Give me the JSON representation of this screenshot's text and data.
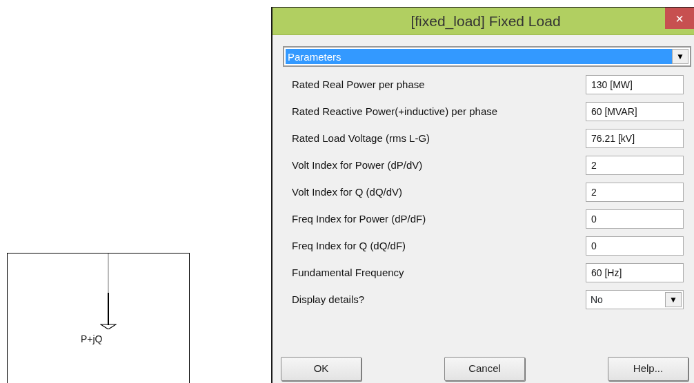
{
  "component": {
    "label": "P+jQ"
  },
  "window": {
    "title": "[fixed_load] Fixed Load",
    "close": "×"
  },
  "section_select": {
    "value": "Parameters",
    "arrow": "▼"
  },
  "parameters": [
    {
      "label": "Rated Real Power per phase",
      "kind": "text",
      "value": "130 [MW]"
    },
    {
      "label": "Rated Reactive Power(+inductive) per phase",
      "kind": "text",
      "value": "60 [MVAR]"
    },
    {
      "label": "Rated Load Voltage (rms L-G)",
      "kind": "text",
      "value": "76.21 [kV]"
    },
    {
      "label": "Volt Index for Power (dP/dV)",
      "kind": "text",
      "value": "2"
    },
    {
      "label": "Volt Index for Q (dQ/dV)",
      "kind": "text",
      "value": "2"
    },
    {
      "label": "Freq Index for Power (dP/dF)",
      "kind": "text",
      "value": "0"
    },
    {
      "label": "Freq Index for Q (dQ/dF)",
      "kind": "text",
      "value": "0"
    },
    {
      "label": "Fundamental Frequency",
      "kind": "text",
      "value": "60 [Hz]"
    },
    {
      "label": "Display details?",
      "kind": "select",
      "value": "No",
      "arrow": "▼"
    }
  ],
  "buttons": [
    "OK",
    "Cancel",
    "Help..."
  ]
}
